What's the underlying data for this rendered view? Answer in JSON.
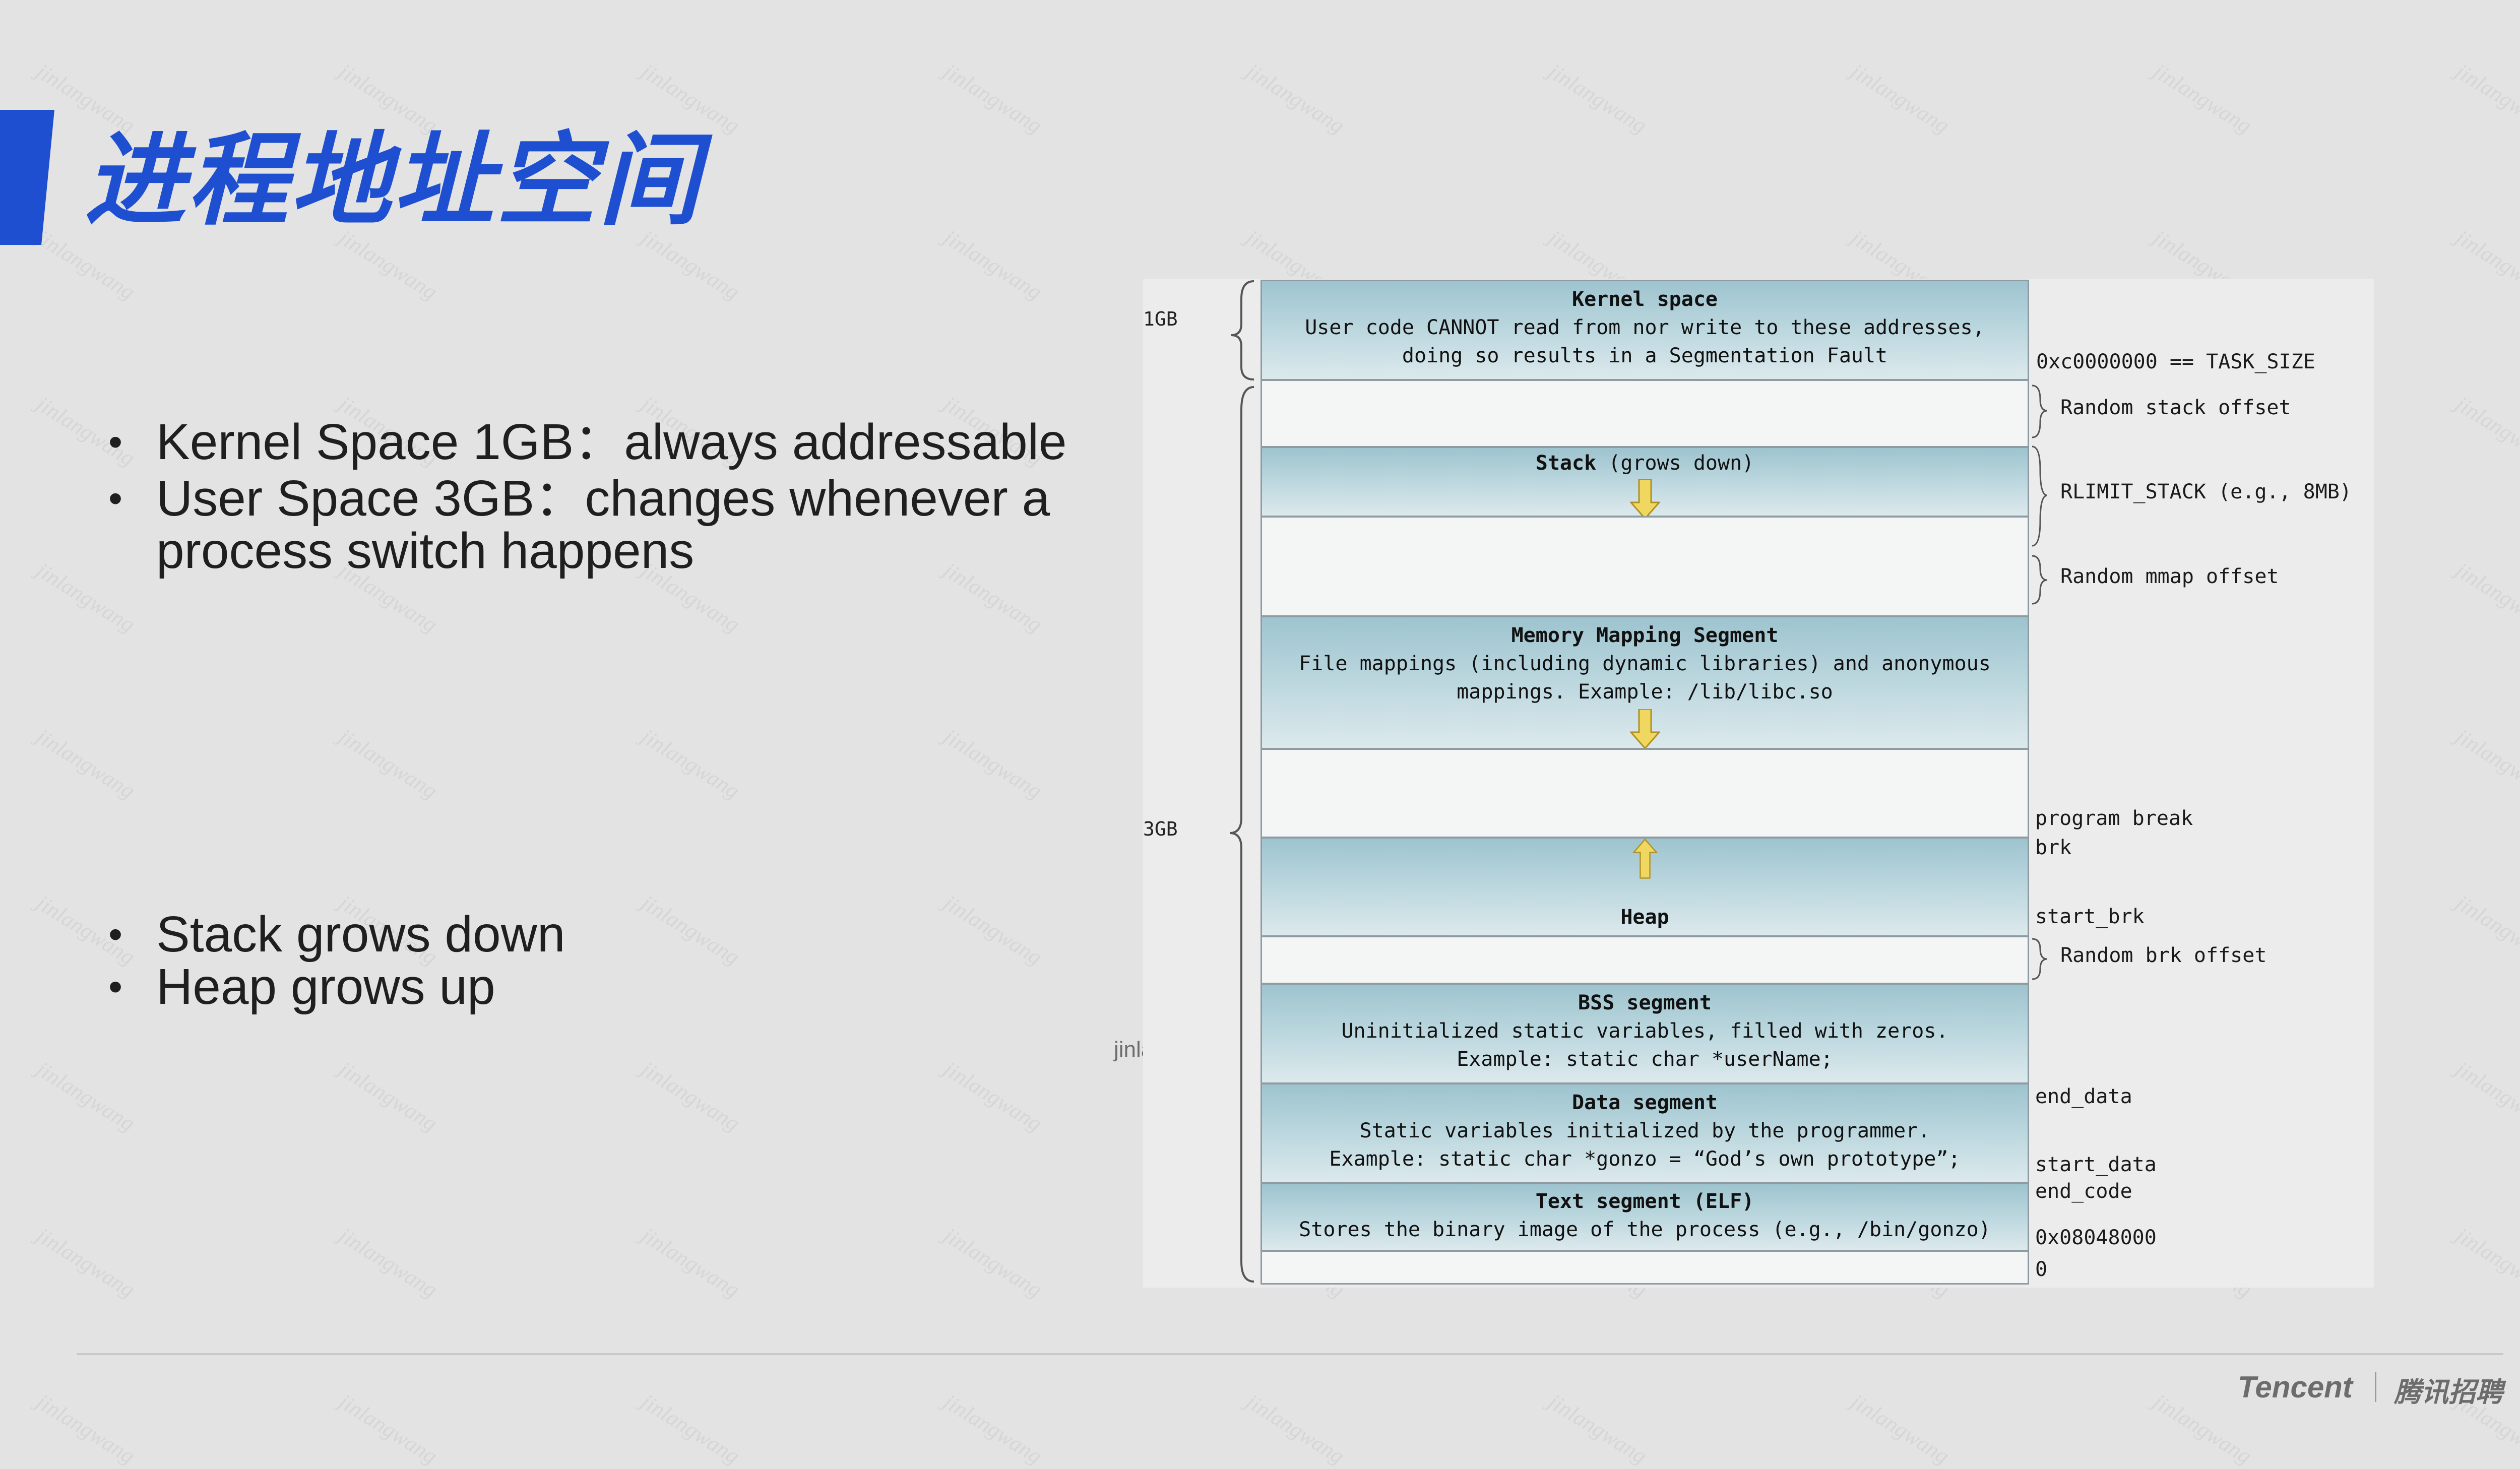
{
  "title": "进程地址空间",
  "bullets_top": [
    "Kernel Space 1GB：always addressable",
    "User Space 3GB：changes whenever a process switch happens"
  ],
  "bullets_bottom": [
    "Stack grows down",
    "Heap grows up"
  ],
  "watermark": "jinlangwang",
  "diagram": {
    "sizes": {
      "kernel": "1GB",
      "user": "3GB"
    },
    "segments": {
      "kernel": {
        "title": "Kernel space",
        "line1": "User code CANNOT read from nor write to these addresses,",
        "line2": "doing so results in a Segmentation Fault"
      },
      "stack": {
        "title": "Stack",
        "note": "(grows down)"
      },
      "mmap": {
        "title": "Memory Mapping Segment",
        "line1": "File mappings (including dynamic libraries) and anonymous",
        "line2": "mappings. Example: /lib/libc.so"
      },
      "heap": {
        "title": "Heap"
      },
      "bss": {
        "title": "BSS segment",
        "line1": "Uninitialized static variables, filled with zeros.",
        "line2": "Example: static char *userName;"
      },
      "data": {
        "title": "Data segment",
        "line1": "Static variables initialized by the programmer.",
        "line2": "Example: static char *gonzo = “God’s own prototype”;"
      },
      "text": {
        "title": "Text segment (ELF)",
        "line1": "Stores the binary image of the process (e.g., /bin/gonzo)"
      }
    },
    "labels": {
      "task_size": "0xc0000000 == TASK_SIZE",
      "random_stack": "Random stack offset",
      "rlimit": "RLIMIT_STACK (e.g., 8MB)",
      "random_mmap": "Random mmap offset",
      "program_break": "program break",
      "brk": "brk",
      "start_brk": "start_brk",
      "random_brk": "Random brk offset",
      "end_data": "end_data",
      "start_data": "start_data",
      "end_code": "end_code",
      "text_addr": "0x08048000",
      "zero": "0"
    }
  },
  "footer": {
    "brand": "Tencent",
    "sub": "腾讯招聘"
  }
}
